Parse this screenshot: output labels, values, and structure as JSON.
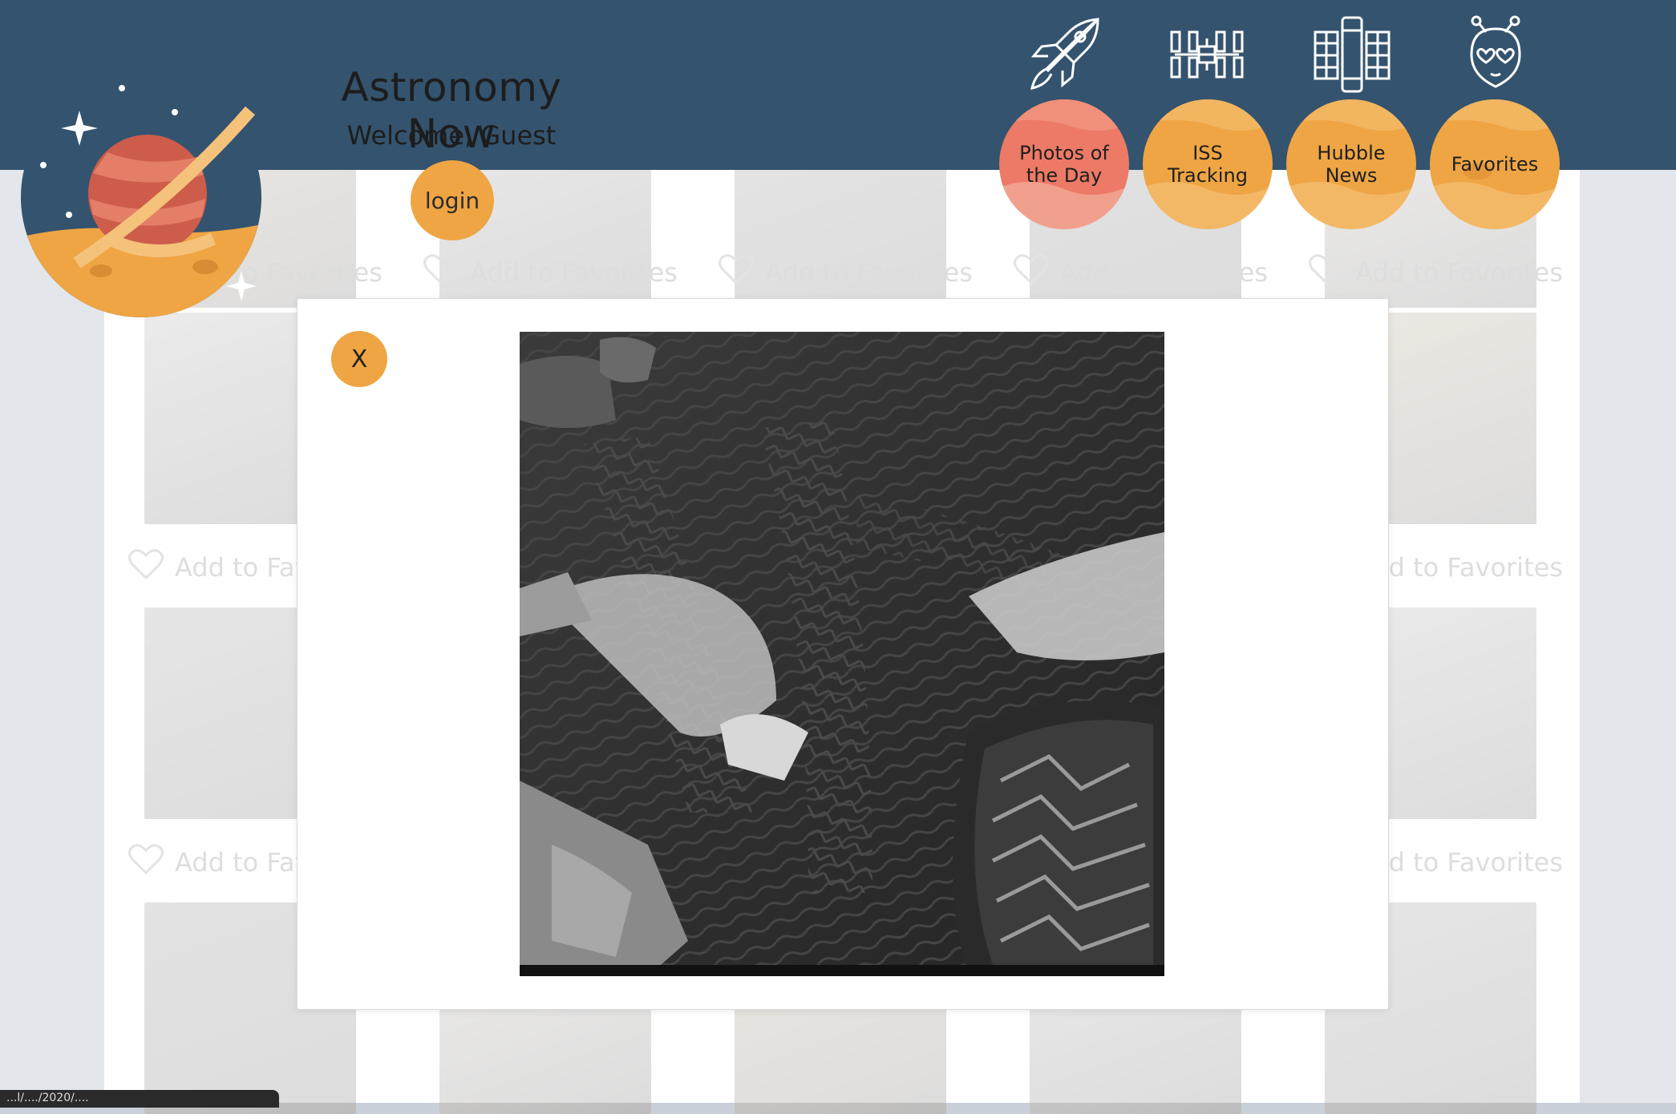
{
  "header": {
    "title": "Astronomy Now",
    "welcome": "Welcome, Guest",
    "login_label": "login",
    "colors": {
      "bar": "#34536e",
      "accent": "#efa543",
      "active": "#ec7a66"
    }
  },
  "nav": {
    "items": [
      {
        "label": "Photos of the Day",
        "icon": "rocket-icon",
        "active": true
      },
      {
        "label": "ISS Tracking",
        "icon": "space-station-icon",
        "active": false
      },
      {
        "label": "Hubble News",
        "icon": "hubble-telescope-icon",
        "active": false
      },
      {
        "label": "Favorites",
        "icon": "alien-heart-icon",
        "active": false
      }
    ]
  },
  "gallery": {
    "add_favorite_label": "Add to Favorites"
  },
  "modal": {
    "close_label": "X",
    "photo_alt": "Mars rover photo"
  },
  "status": {
    "text": "...l/..../2020/...."
  }
}
